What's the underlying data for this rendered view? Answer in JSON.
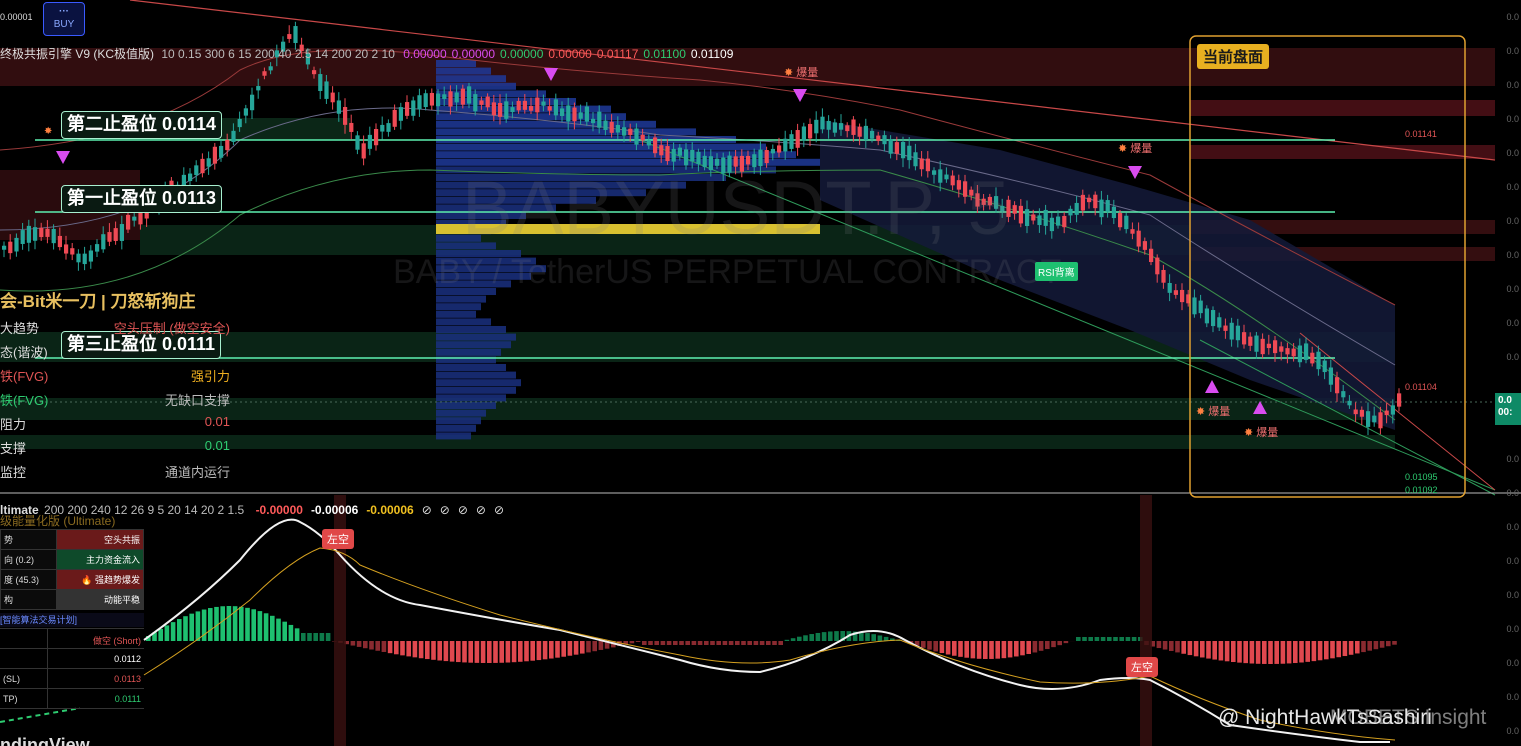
{
  "top": {
    "price_scale_top": "0.00001",
    "buy_button_label": "BUY",
    "buy_button_dots": "···"
  },
  "indicator": {
    "name": "终极共振引擎 V9 (KC极值版)",
    "params": "10 0.15 300 6 15 200 40 2.5 14 200 20 2 10",
    "values": [
      {
        "text": "0.00000",
        "color": "#d94cf0"
      },
      {
        "text": "0.00000",
        "color": "#d94cf0"
      },
      {
        "text": "0.00000",
        "color": "#2ecc71"
      },
      {
        "text": "0.00000",
        "color": "#ff5a5a"
      },
      {
        "text": "0.01117",
        "color": "#ff5a5a"
      },
      {
        "text": "0.01100",
        "color": "#2ecc71"
      },
      {
        "text": "0.01109",
        "color": "#ffffff"
      }
    ]
  },
  "watermark": {
    "symbol": "BABYUSDT.P, 5",
    "description": "BABY / TetherUS PERPETUAL CONTRACT"
  },
  "take_profit": {
    "tp2": "第二止盈位 0.0114",
    "tp1": "第一止盈位 0.0113",
    "tp3": "第三止盈位 0.0111"
  },
  "current_box_label": "当前盘面",
  "markers": {
    "burst": "爆量",
    "rsi_divergence": "RSI背离",
    "short_left": "左空"
  },
  "dashboard": {
    "title": "会-Bit米一刀 | 刀怒斩狗庄",
    "rows": [
      {
        "key": "大趋势",
        "value": "空头压制 (做空安全)",
        "color": "#e05555"
      },
      {
        "key": "态(谐波)",
        "value": "",
        "color": "#ccc"
      },
      {
        "key": "铁(FVG)",
        "value": "强引力",
        "color": "#f0b020"
      },
      {
        "key": "铁(FVG)",
        "value": "无缺口支撑",
        "color": "#bbbbbb"
      },
      {
        "key": "阻力",
        "value": "0.01",
        "color": "#e05555"
      },
      {
        "key": "支撑",
        "value": "0.01",
        "color": "#2ecc71"
      },
      {
        "key": "监控",
        "value": "通道内运行",
        "color": "#bbbbbb"
      }
    ]
  },
  "right_prices": {
    "p1": "0.01141",
    "p2": "0.01104",
    "p3": "0.01095",
    "p4": "0.01092",
    "current_a": "0.0",
    "current_b": "00:"
  },
  "lower": {
    "name": "ltimate",
    "params": "200 200 240 12 26 9 5 20 14 20 2 1.5",
    "values": [
      {
        "text": "-0.00000",
        "color": "#ff5a5a"
      },
      {
        "text": "-0.00006",
        "color": "#ffffff"
      },
      {
        "text": "-0.00006",
        "color": "#f0c020"
      }
    ],
    "null_icons": [
      "⊘",
      "⊘",
      "⊘",
      "⊘",
      "⊘"
    ],
    "subtitle": "级能量化版 (Ultimate)",
    "table": [
      {
        "k": "势",
        "v": "空头共振",
        "bg": "#6a1a1a",
        "fg": "#fff"
      },
      {
        "k": "向 (0.2)",
        "v": "主力资金流入",
        "bg": "#0e4a2a",
        "fg": "#fff"
      },
      {
        "k": "度 (45.3)",
        "v": "🔥 强趋势爆发",
        "bg": "#6a1a1a",
        "fg": "#fff"
      },
      {
        "k": "构",
        "v": "动能平稳",
        "bg": "#333",
        "fg": "#fff"
      }
    ],
    "plan_title": "[智能算法交易计划]",
    "plan_rows": [
      {
        "k": "",
        "v": "做空 (Short)",
        "fg": "#e05555"
      },
      {
        "k": "",
        "v": "0.0112",
        "fg": "#ffffff"
      },
      {
        "k": "(SL)",
        "v": "0.0113",
        "fg": "#e05555"
      },
      {
        "k": "TP)",
        "v": "0.0111",
        "fg": "#2ecc71"
      }
    ],
    "tv_logo": "ndingView",
    "credit": "@ NightHawkTsSashiri",
    "credit_overlap": "MOBETS Insight"
  }
}
